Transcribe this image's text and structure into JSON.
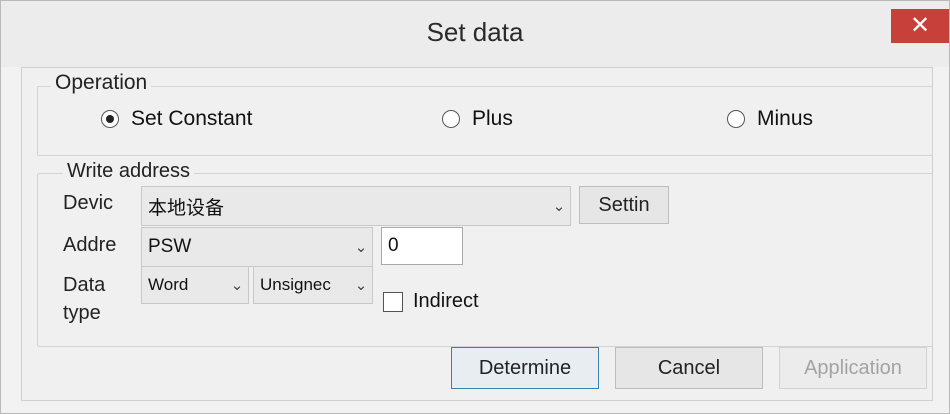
{
  "window": {
    "title": "Set data",
    "close_glyph": "✕"
  },
  "operation": {
    "legend": "Operation",
    "options": [
      {
        "label": "Set Constant",
        "checked": true
      },
      {
        "label": "Plus",
        "checked": false
      },
      {
        "label": "Minus",
        "checked": false
      }
    ]
  },
  "write_address": {
    "legend": "Write address",
    "device_label": "Devic",
    "device_value": "本地设备",
    "settings_label": "Settin",
    "address_label": "Addre",
    "address_type_value": "PSW",
    "address_value": "0",
    "data_type_label_line1": "Data",
    "data_type_label_line2": "type",
    "data_width_value": "Word",
    "data_sign_value": "Unsignec",
    "indirect_label": "Indirect"
  },
  "footer": {
    "determine_label": "Determine",
    "cancel_label": "Cancel",
    "application_label": "Application"
  },
  "icons": {
    "chevron": "⌄"
  }
}
